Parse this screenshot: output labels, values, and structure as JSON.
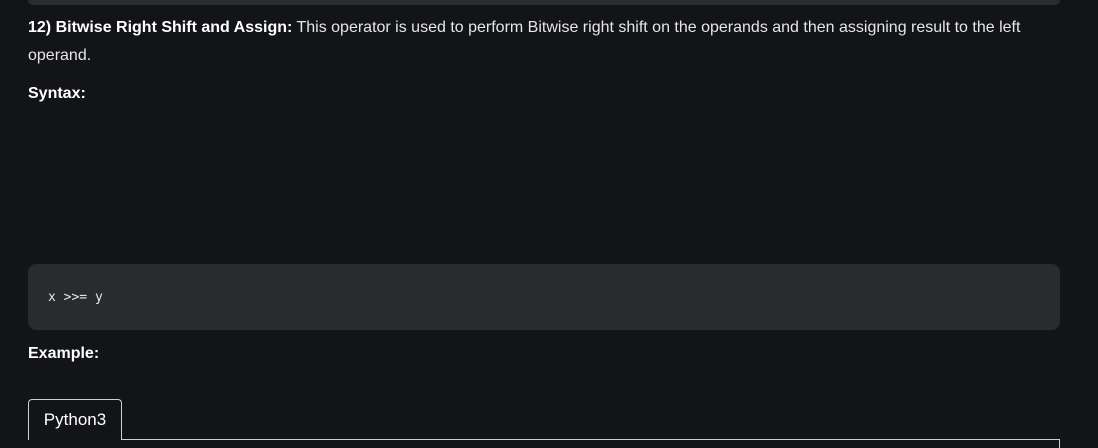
{
  "article": {
    "heading_bold": "12) Bitwise Right Shift and Assign:",
    "description": " This operator is used to perform Bitwise right shift on the operands and then assigning result to the left operand.",
    "syntax_label": "Syntax:",
    "code": "x >>= y",
    "example_label": "Example:"
  },
  "tabs": {
    "active": "Python3"
  }
}
